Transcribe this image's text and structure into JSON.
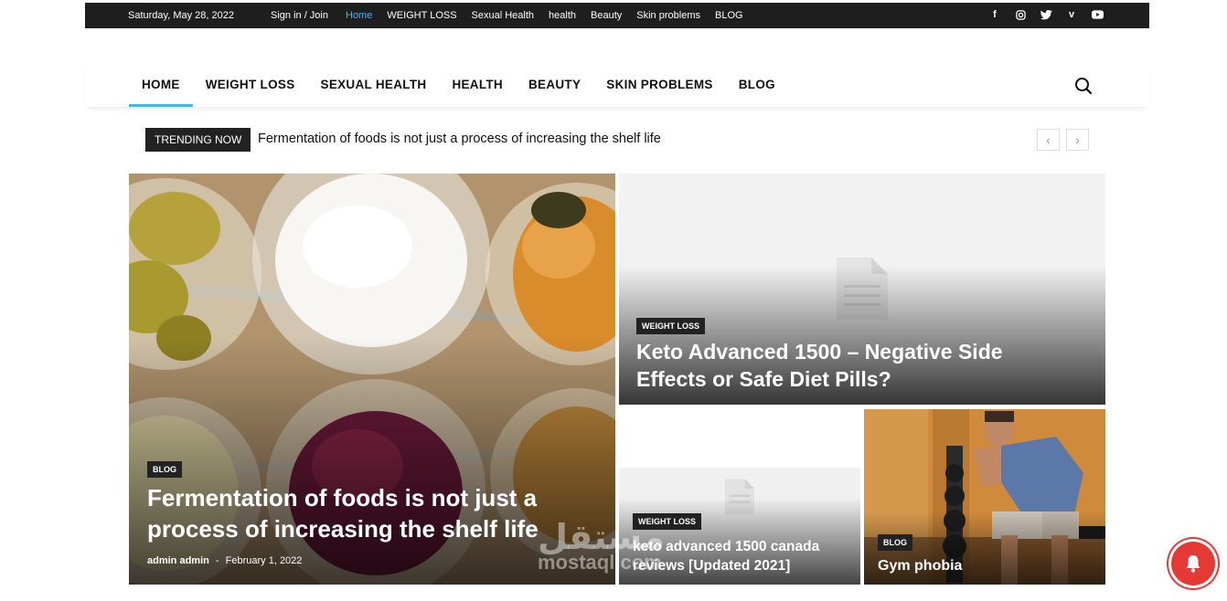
{
  "topbar": {
    "date": "Saturday, May 28, 2022",
    "signin": "Sign in / Join",
    "links": [
      "Home",
      "WEIGHT LOSS",
      "Sexual Health",
      "health",
      "Beauty",
      "Skin problems",
      "BLOG"
    ],
    "active_link": "Home",
    "social": [
      "facebook-icon",
      "instagram-icon",
      "twitter-icon",
      "vimeo-icon",
      "youtube-icon"
    ]
  },
  "nav": {
    "items": [
      "HOME",
      "WEIGHT LOSS",
      "SEXUAL HEALTH",
      "HEALTH",
      "BEAUTY",
      "SKIN PROBLEMS",
      "BLOG"
    ],
    "active": "HOME"
  },
  "trending": {
    "label": "TRENDING NOW",
    "title": "Fermentation of foods is not just a process of increasing the shelf life",
    "prev": "‹",
    "next": "›"
  },
  "posts": {
    "main": {
      "category": "BLOG",
      "title_line1": "Fermentation of foods is not just a",
      "title_line2": "process of increasing the shelf life",
      "author": "admin admin",
      "separator": "-",
      "date": "February 1, 2022"
    },
    "top_right": {
      "category": "WEIGHT LOSS",
      "title_line1": "Keto Advanced 1500 – Negative Side",
      "title_line2": "Effects or Safe Diet Pills?"
    },
    "bottom_left": {
      "category": "WEIGHT LOSS",
      "title_line1": "keto advanced 1500 canada",
      "title_line2": "reviews [Updated 2021]"
    },
    "bottom_right": {
      "category": "BLOG",
      "title": "Gym phobia"
    }
  },
  "watermark": {
    "arabic": "مستقل",
    "latin": "mostaql.com"
  },
  "colors": {
    "accent": "#4db2ec",
    "topbar_bg": "#1e1e1e",
    "badge": "#e53935"
  }
}
